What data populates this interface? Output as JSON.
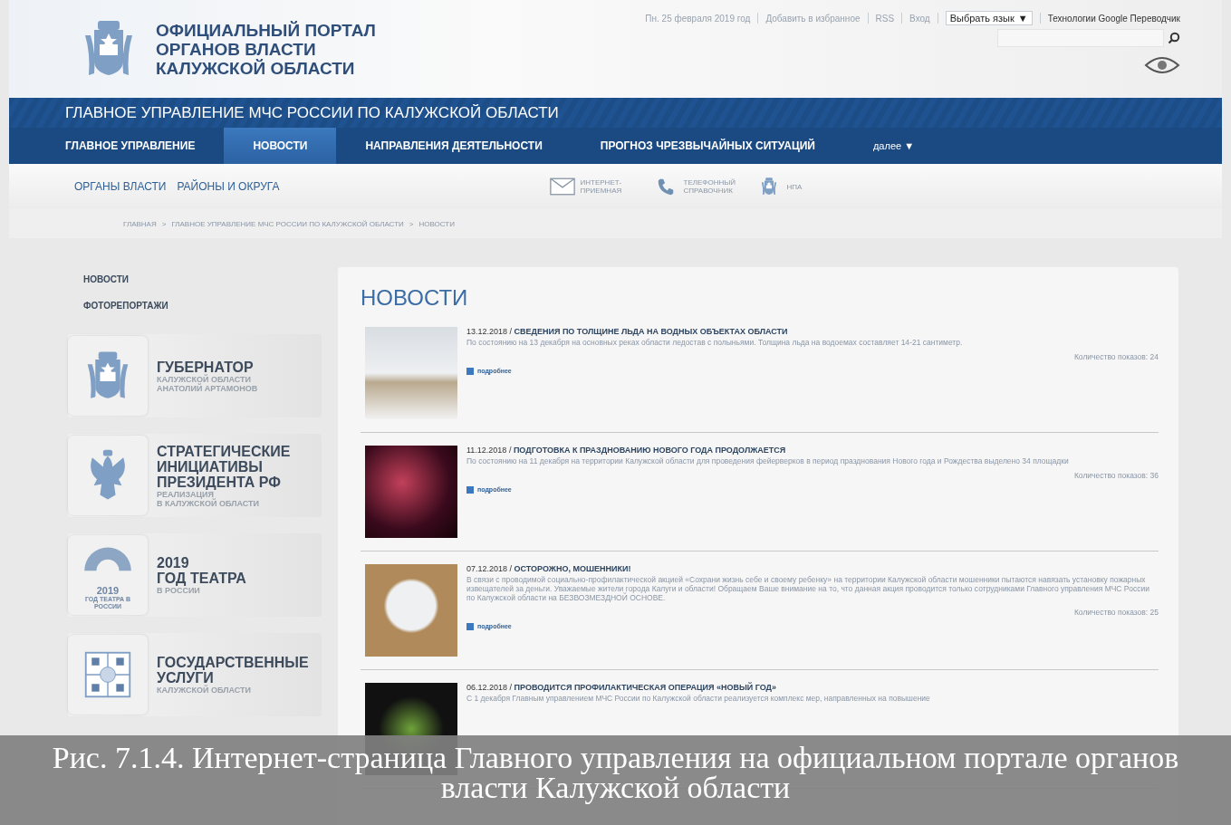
{
  "header": {
    "title_lines": [
      "ОФИЦИАЛЬНЫЙ ПОРТАЛ",
      "ОРГАНОВ ВЛАСТИ",
      "КАЛУЖСКОЙ ОБЛАСТИ"
    ],
    "top_links": [
      "Пн. 25 февраля 2019 год",
      "Добавить в избранное",
      "RSS",
      "Вход"
    ],
    "language_select": "Выбрать язык",
    "language_caret": "▼",
    "translator": "Технологии Google Переводчик"
  },
  "department_title": "ГЛАВНОЕ УПРАВЛЕНИЕ МЧС РОССИИ ПО КАЛУЖСКОЙ ОБЛАСТИ",
  "nav": [
    {
      "label": "ГЛАВНОЕ УПРАВЛЕНИЕ",
      "selected": false
    },
    {
      "label": "НОВОСТИ",
      "selected": true
    },
    {
      "label": "НАПРАВЛЕНИЯ ДЕЯТЕЛЬНОСТИ",
      "selected": false
    },
    {
      "label": "ПРОГНОЗ ЧРЕЗВЫЧАЙНЫХ СИТУАЦИЙ",
      "selected": false
    },
    {
      "label": "далее ▼",
      "selected": false
    }
  ],
  "subnav": {
    "links": [
      "ОРГАНЫ ВЛАСТИ",
      "РАЙОНЫ И ОКРУГА"
    ],
    "services": [
      {
        "kind": "envelope",
        "label": "ИНТЕРНЕТ-ПРИЕМНАЯ"
      },
      {
        "kind": "phone",
        "label": "ТЕЛЕФОННЫЙ СПРАВОЧНИК"
      },
      {
        "kind": "emblem",
        "label": "НПА"
      }
    ]
  },
  "breadcrumb": [
    "ГЛАВНАЯ",
    ">",
    "ГЛАВНОЕ УПРАВЛЕНИЕ МЧС РОССИИ ПО КАЛУЖСКОЙ ОБЛАСТИ",
    ">",
    "НОВОСТИ"
  ],
  "sidebar": {
    "links": [
      "НОВОСТИ",
      "ФОТОРЕПОРТАЖИ"
    ],
    "cards": [
      {
        "kind": "emblem",
        "title_lines": [
          "ГУБЕРНАТОР"
        ],
        "subtitle_lines": [
          "КАЛУЖСКОЙ ОБЛАСТИ",
          "АНАТОЛИЙ АРТАМОНОВ"
        ]
      },
      {
        "kind": "eagle",
        "title_lines": [
          "СТРАТЕГИЧЕСКИЕ",
          "ИНИЦИАТИВЫ",
          "ПРЕЗИДЕНТА РФ"
        ],
        "subtitle_lines": [
          "РЕАЛИЗАЦИЯ",
          "В КАЛУЖСКОЙ ОБЛАСТИ"
        ]
      },
      {
        "kind": "theatre",
        "logo_text": "2019",
        "logo_caption": "ГОД ТЕАТРА В РОССИИ",
        "title_lines": [
          "2019",
          "ГОД ТЕАТРА"
        ],
        "subtitle_lines": [
          "В РОССИИ"
        ]
      },
      {
        "kind": "services",
        "title_lines": [
          "ГОСУДАРСТВЕННЫЕ",
          "УСЛУГИ"
        ],
        "subtitle_lines": [
          "КАЛУЖСКОЙ ОБЛАСТИ"
        ]
      }
    ]
  },
  "news": {
    "heading": "НОВОСТИ",
    "items": [
      {
        "headline": "13.12.2018 / **СВЕДЕНИЯ ПО ТОЛЩИНЕ ЛЬДА НА ВОДНЫХ ОБЪЕКТАХ ОБЛАСТИ**",
        "text": "По состоянию на 13 декабря на основных реках области ледостав с полыньями. Толщина льда на водоемах составляет 14-21 сантиметр.",
        "views": "Количество показов: 24",
        "more": "подробнее"
      },
      {
        "headline": "11.12.2018 / **ПОДГОТОВКА К ПРАЗДНОВАНИЮ НОВОГО ГОДА ПРОДОЛЖАЕТСЯ**",
        "text": "По состоянию на 11 декабря на территории Калужской области для проведения фейерверков в период празднования Нового года и Рождества выделено 34 площадки",
        "views": "Количество показов: 36",
        "more": "подробнее"
      },
      {
        "headline": "07.12.2018 / **ОСТОРОЖНО, МОШЕННИКИ!**",
        "text": "В связи с проводимой социально-профилактической акцией «Сохрани жизнь себе и своему ребенку» на территории Калужской области мошенники пытаются навязать установку пожарных извещателей за деньги. Уважаемые жители города Калуги и области! Обращаем Ваше внимание на то, что данная акция проводится только сотрудниками Главного управления МЧС России по Калужской области на БЕЗВОЗМЕЗДНОЙ ОСНОВЕ.",
        "views": "Количество показов: 25",
        "more": "подробнее"
      },
      {
        "headline": "06.12.2018 / **ПРОВОДИТСЯ ПРОФИЛАКТИЧЕСКАЯ ОПЕРАЦИЯ «НОВЫЙ ГОД»**",
        "text": "С 1 декабря Главным управлением МЧС России по Калужской области реализуется комплекс мер, направленных на повышение"
      }
    ]
  },
  "caption": "Рис. 7.1.4. Интернет-страница Главного управления на официальном портале органов власти Калужской области"
}
